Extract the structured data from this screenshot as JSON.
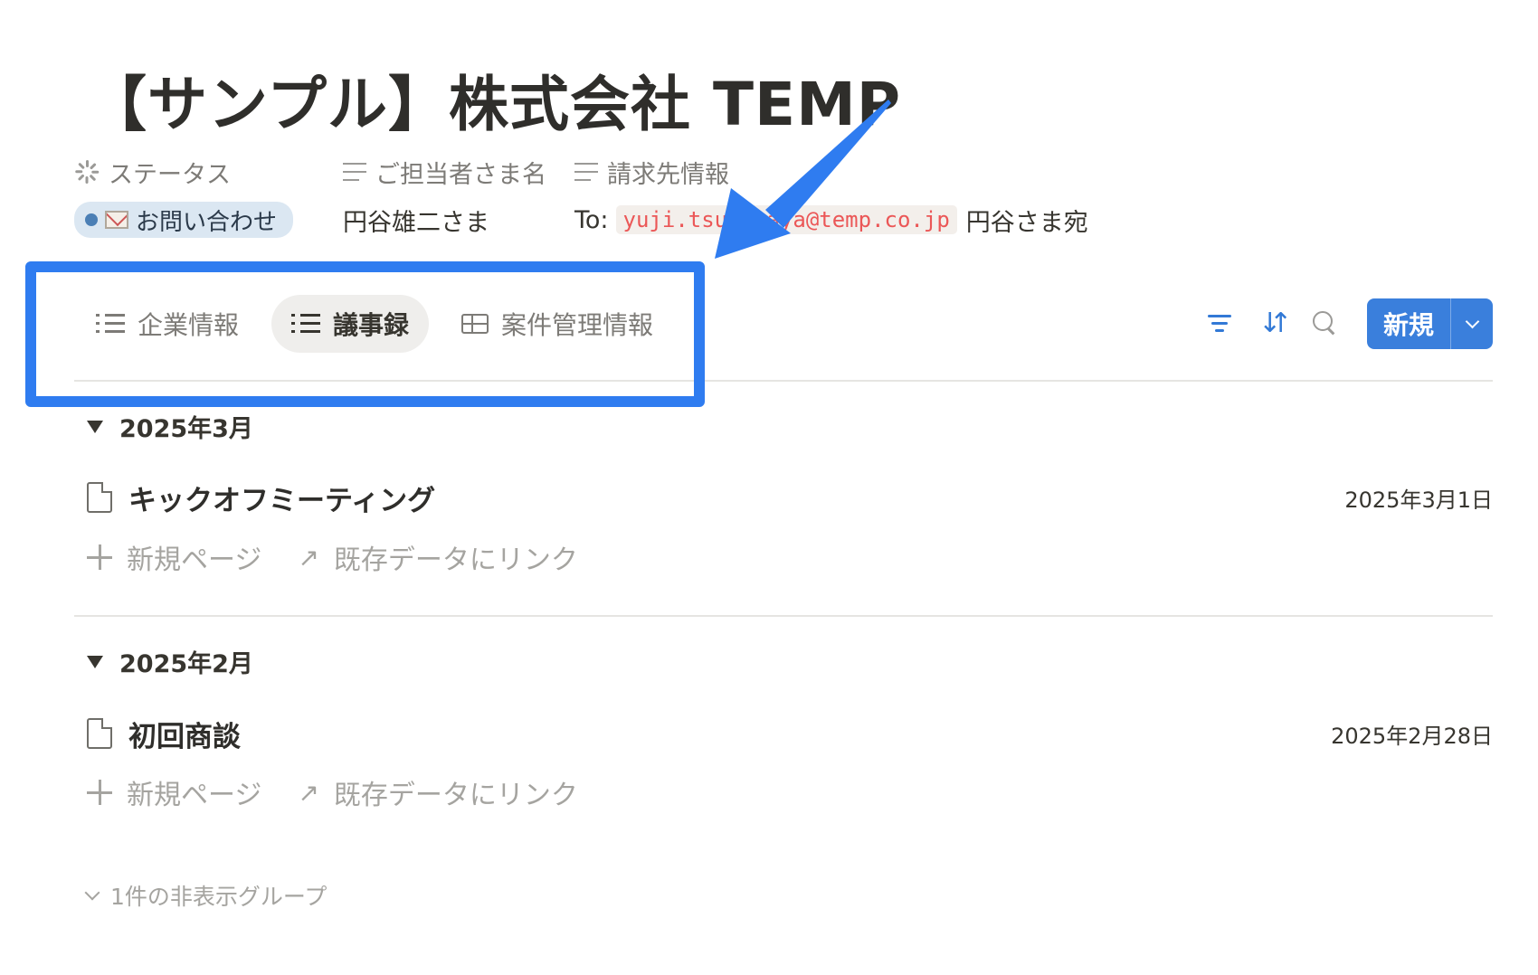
{
  "page": {
    "title": "【サンプル】株式会社 TEMP"
  },
  "properties": {
    "status": {
      "label": "ステータス",
      "value": "お問い合わせ"
    },
    "contact": {
      "label": "ご担当者さま名",
      "value": "円谷雄二さま"
    },
    "billing": {
      "label": "請求先情報",
      "prefix": "To:",
      "email": "yuji.tsuburaya@temp.co.jp",
      "suffix": "円谷さま宛"
    }
  },
  "tabs": [
    {
      "label": "企業情報",
      "icon": "list-icon",
      "active": false
    },
    {
      "label": "議事録",
      "icon": "list-icon",
      "active": true
    },
    {
      "label": "案件管理情報",
      "icon": "table-icon",
      "active": false
    }
  ],
  "toolbar": {
    "filter_icon": "filter-icon",
    "sort_icon": "sort-icon",
    "search_icon": "search-icon",
    "new_label": "新規"
  },
  "groups": [
    {
      "header": "2025年3月",
      "rows": [
        {
          "title": "キックオフミーティング",
          "date": "2025年3月1日"
        }
      ]
    },
    {
      "header": "2025年2月",
      "rows": [
        {
          "title": "初回商談",
          "date": "2025年2月28日"
        }
      ]
    }
  ],
  "group_actions": {
    "new_page": "新規ページ",
    "link_existing": "既存データにリンク"
  },
  "hidden_groups_label": "1件の非表示グループ",
  "colors": {
    "accent": "#3a7fdc",
    "annotation": "#2f7cf0",
    "status_pill": "#dbe7f2",
    "email_text": "#eb5757"
  }
}
